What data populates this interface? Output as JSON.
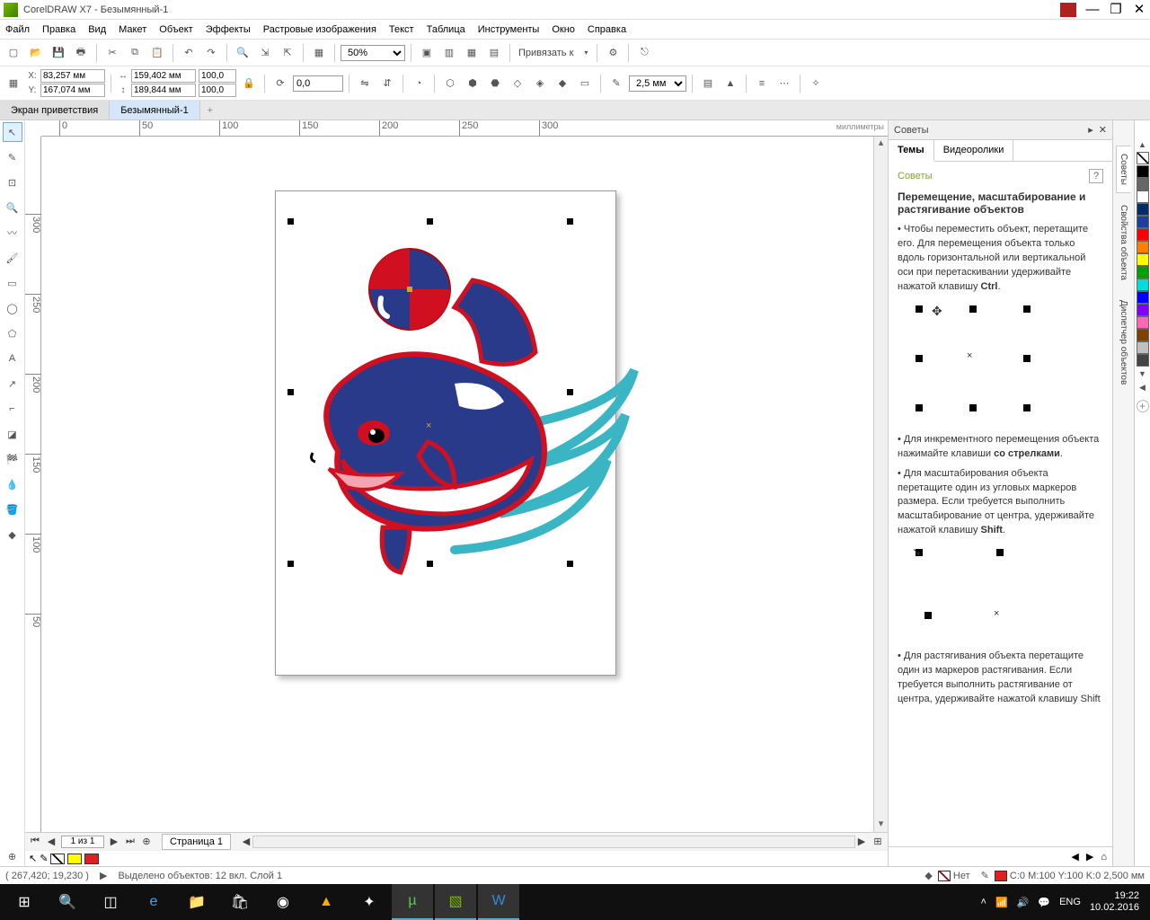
{
  "app": {
    "title": "CorelDRAW X7 - Безымянный-1"
  },
  "menu": [
    "Файл",
    "Правка",
    "Вид",
    "Макет",
    "Объект",
    "Эффекты",
    "Растровые изображения",
    "Текст",
    "Таблица",
    "Инструменты",
    "Окно",
    "Справка"
  ],
  "toolbar1": {
    "zoom": "50%",
    "snap_label": "Привязать к"
  },
  "toolbar2": {
    "x": "83,257 мм",
    "y": "167,074 мм",
    "w": "159,402 мм",
    "h": "189,844 мм",
    "sx": "100,0",
    "sy": "100,0",
    "rot": "0,0",
    "outline": "2,5 мм"
  },
  "doctabs": {
    "welcome": "Экран приветствия",
    "doc": "Безымянный-1"
  },
  "ruler_unit": "миллиметры",
  "ruler_h_ticks": [
    0,
    50,
    100,
    150,
    200,
    250,
    300
  ],
  "ruler_v_ticks": [
    50,
    100,
    150,
    200,
    250,
    300
  ],
  "pagenav": {
    "page_of": "1 из 1",
    "page_tab": "Страница 1"
  },
  "docker": {
    "title": "Советы",
    "tabs": {
      "themes": "Темы",
      "videos": "Видеоролики"
    },
    "h3": "Советы",
    "h4": "Перемещение, масштабирование и растягивание объектов",
    "p1a": "Чтобы переместить объект, перетащите его. Для перемещения объекта только вдоль горизонтальной или вертикальной оси при перетаскивании удерживайте нажатой клавишу ",
    "p1b": "Ctrl",
    "p2a": "Для инкрементного перемещения объекта нажимайте клавиши ",
    "p2b": "со стрелками",
    "p3a": "Для масштабирования объекта перетащите один из угловых маркеров размера. Если требуется выполнить масштабирование от центра, удерживайте нажатой клавишу ",
    "p3b": "Shift",
    "p4": "Для растягивания объекта перетащите один из маркеров растягивания. Если требуется выполнить растягивание от центра, удерживайте нажатой клавишу Shift"
  },
  "vtabs": [
    "Советы",
    "Свойства объекта",
    "Диспетчер объектов"
  ],
  "palette_colors": [
    "#000",
    "#666",
    "#fff",
    "#052b6a",
    "#1e3fa0",
    "#ff0000",
    "#ff7f00",
    "#ffff00",
    "#00a000",
    "#00dddd",
    "#0000ff",
    "#8000ff",
    "#ff69b4",
    "#804000",
    "#c0c0c0",
    "#444"
  ],
  "statusbar": {
    "cursor": "( 267,420; 19,230 )",
    "selection": "Выделено объектов: 12 вкл. Слой 1",
    "fill_none": "Нет",
    "cmyk": "C:0 M:100 Y:100 K:0  2,500 мм"
  },
  "taskbar": {
    "lang": "ENG",
    "time": "19:22",
    "date": "10.02.2016"
  }
}
